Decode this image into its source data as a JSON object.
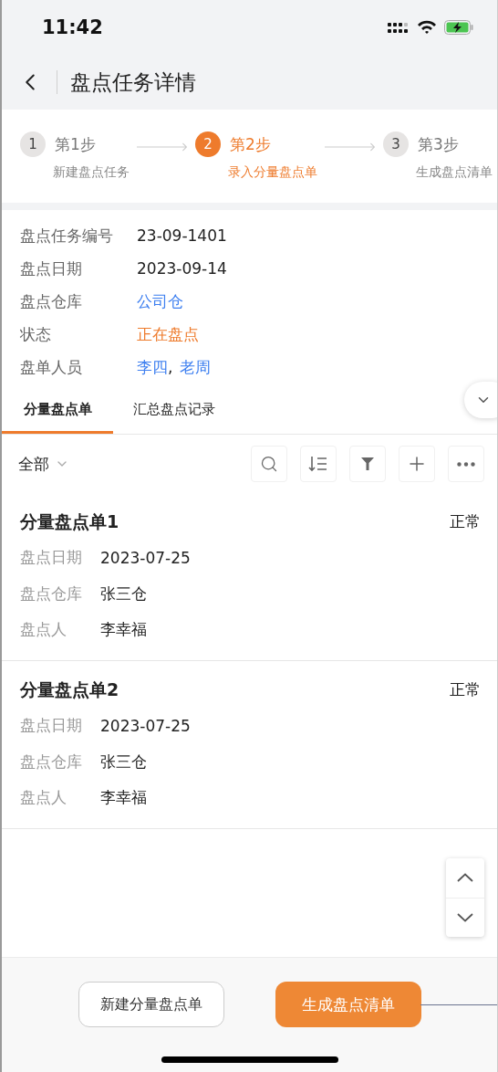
{
  "status_bar": {
    "time": "11:42"
  },
  "nav": {
    "title": "盘点任务详情"
  },
  "steps": [
    {
      "number": "1",
      "title": "第1步",
      "subtitle": "新建盘点任务",
      "selected": false
    },
    {
      "number": "2",
      "title": "第2步",
      "subtitle": "录入分量盘点单",
      "selected": true
    },
    {
      "number": "3",
      "title": "第3步",
      "subtitle": "生成盘点清单",
      "selected": false
    }
  ],
  "info": [
    {
      "label": "盘点任务编号",
      "kind": "text",
      "value": "23-09-1401"
    },
    {
      "label": "盘点日期",
      "kind": "text",
      "value": "2023-09-14"
    },
    {
      "label": "盘点仓库",
      "kind": "link",
      "value": "公司仓"
    },
    {
      "label": "状态",
      "kind": "status",
      "value": "正在盘点"
    },
    {
      "label": "盘单人员",
      "kind": "links",
      "links": [
        "李四",
        "老周"
      ],
      "separator": ","
    }
  ],
  "tabs": [
    {
      "label": "分量盘点单",
      "selected": true
    },
    {
      "label": "汇总盘点记录",
      "selected": false
    }
  ],
  "filter": {
    "value": "全部"
  },
  "cards": [
    {
      "title": "分量盘点单1",
      "status": "正常",
      "fields": [
        {
          "label": "盘点日期",
          "value": "2023-07-25"
        },
        {
          "label": "盘点仓库",
          "value": "张三仓"
        },
        {
          "label": "盘点人",
          "value": "李幸福"
        }
      ]
    },
    {
      "title": "分量盘点单2",
      "status": "正常",
      "fields": [
        {
          "label": "盘点日期",
          "value": "2023-07-25"
        },
        {
          "label": "盘点仓库",
          "value": "张三仓"
        },
        {
          "label": "盘点人",
          "value": "李幸福"
        }
      ]
    }
  ],
  "footer": {
    "secondary_button": "新建分量盘点单",
    "primary_button": "生成盘点清单"
  }
}
